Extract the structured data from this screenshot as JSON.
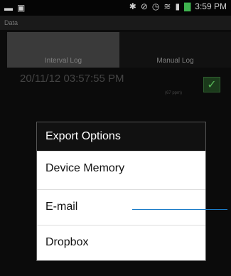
{
  "statusbar": {
    "time": "3:59 PM"
  },
  "app": {
    "title": "Data"
  },
  "tabs": [
    {
      "label": "Interval Log"
    },
    {
      "label": "Manual Log"
    }
  ],
  "log_entry": {
    "timestamp": "20/11/12 03:57:55 PM",
    "unit": "(67 ppm)"
  },
  "dialog": {
    "title": "Export Options",
    "items": [
      {
        "label": "Device Memory"
      },
      {
        "label": "E-mail"
      },
      {
        "label": "Dropbox"
      }
    ]
  },
  "colors": {
    "accent": "#1b7cc8",
    "check": "#57b657"
  }
}
